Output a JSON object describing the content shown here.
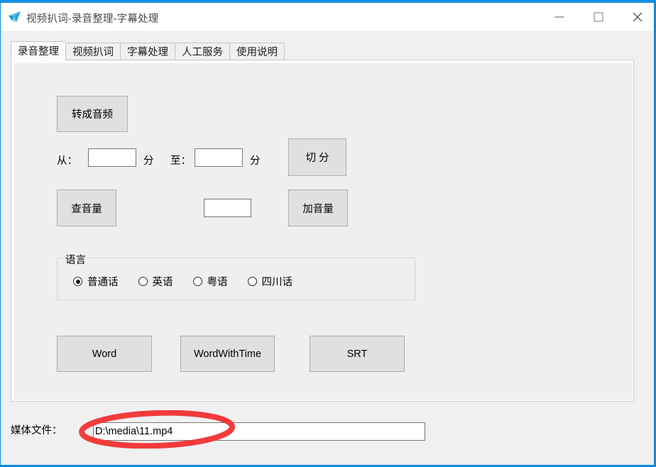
{
  "window": {
    "title": "视频扒词-录音整理-字幕处理",
    "icon": "app-paperplane-icon",
    "accent_color": "#1490e2",
    "controls": {
      "minimize": "minimize-icon",
      "maximize": "maximize-icon",
      "close": "close-icon"
    }
  },
  "tabs": [
    {
      "label": "录音整理",
      "active": true
    },
    {
      "label": "视频扒词",
      "active": false
    },
    {
      "label": "字幕处理",
      "active": false
    },
    {
      "label": "人工服务",
      "active": false
    },
    {
      "label": "使用说明",
      "active": false
    }
  ],
  "panel": {
    "convert_button": "转成音频",
    "from_label": "从：",
    "from_value": "",
    "from_unit": "分",
    "to_label": "至：",
    "to_value": "",
    "to_unit": "分",
    "split_button": "切 分",
    "check_volume_button": "查音量",
    "volume_value": "",
    "add_volume_button": "加音量",
    "language_group": {
      "title": "语言",
      "options": [
        {
          "label": "普通话",
          "selected": true
        },
        {
          "label": "英语",
          "selected": false
        },
        {
          "label": "粤语",
          "selected": false
        },
        {
          "label": "四川话",
          "selected": false
        }
      ]
    },
    "export_buttons": [
      {
        "label": "Word"
      },
      {
        "label": "WordWithTime"
      },
      {
        "label": "SRT"
      }
    ]
  },
  "footer": {
    "media_label": "媒体文件：",
    "media_path": "D:\\media\\11.mp4",
    "media_placeholder": ""
  },
  "annotation": {
    "shape": "ellipse",
    "color": "#f23b3b",
    "target": "media-file-input"
  }
}
